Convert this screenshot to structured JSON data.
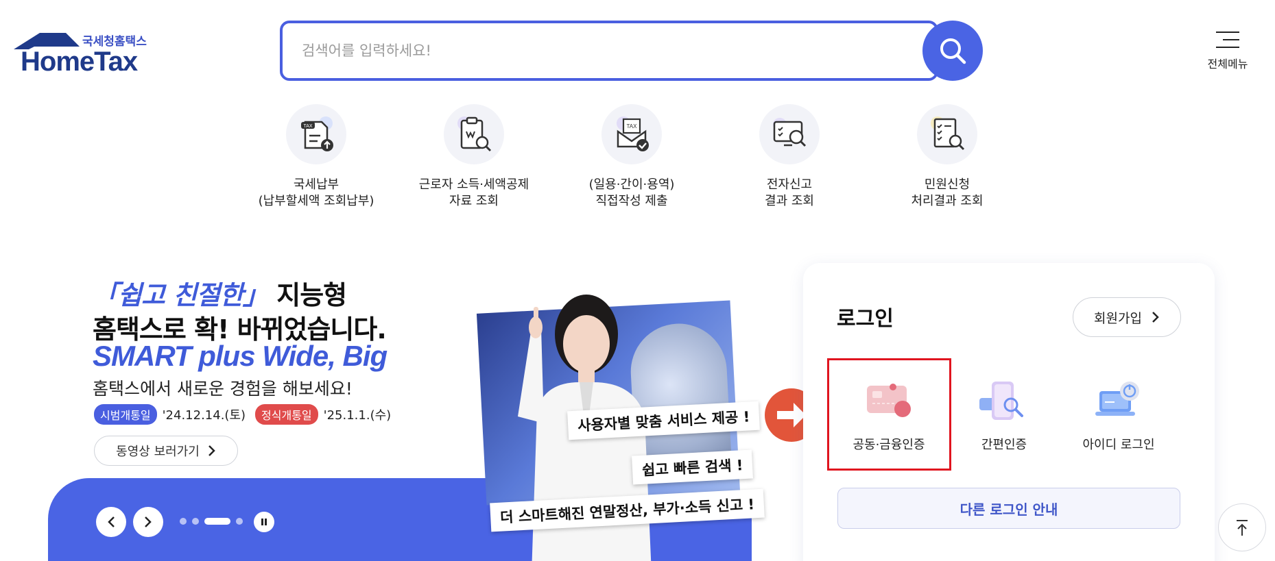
{
  "header": {
    "logo_sub": "국세청홈택스",
    "logo_main": "HomeTax",
    "search_placeholder": "검색어를 입력하세요!",
    "menu_label": "전체메뉴"
  },
  "quick_menu": [
    {
      "label": "국세납부\n(납부할세액 조회납부)",
      "icon": "tax-payment-icon"
    },
    {
      "label": "근로자 소득·세액공제\n자료 조회",
      "icon": "deduction-search-icon"
    },
    {
      "label": "(일용·간이·용역)\n직접작성 제출",
      "icon": "tax-submit-icon"
    },
    {
      "label": "전자신고\n결과 조회",
      "icon": "e-filing-result-icon"
    },
    {
      "label": "민원신청\n처리결과 조회",
      "icon": "civil-result-icon"
    }
  ],
  "hero": {
    "title1_accent": "「쉽고 친절한」",
    "title1_rest": " 지능형",
    "title2": "홈택스로 확! 바뀌었습니다.",
    "title3": "SMART plus Wide, Big",
    "subtitle": "홈택스에서 새로운 경험을 해보세요!",
    "badge1": "시범개통일",
    "date1": "'24.12.14.(토)",
    "badge2": "정식개통일",
    "date2": "'25.1.1.(수)",
    "video_button": "동영상 보러가기",
    "captions": [
      "사용자별 맞춤 서비스 제공 !",
      "쉽고 빠른 검색 !",
      "더 스마트해진 연말정산, 부가·소득 신고 !"
    ],
    "carousel": {
      "total": 4,
      "active": 3
    }
  },
  "login": {
    "title": "로그인",
    "signup": "회원가입",
    "options": [
      {
        "label": "공동·금융인증",
        "icon": "certificate-card-icon"
      },
      {
        "label": "간편인증",
        "icon": "simple-auth-icon"
      },
      {
        "label": "아이디 로그인",
        "icon": "id-login-icon"
      }
    ],
    "other": "다른 로그인 안내"
  },
  "colors": {
    "brand_blue": "#4a64e4",
    "accent_red": "#e2553a",
    "highlight_red": "#e0141f"
  }
}
